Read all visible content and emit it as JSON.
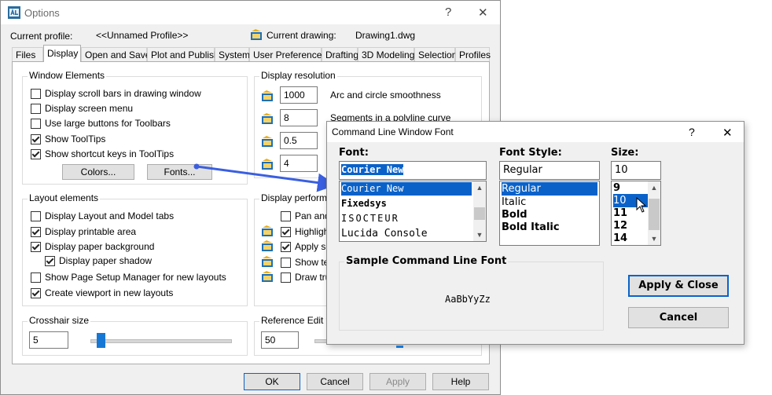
{
  "options": {
    "title": "Options",
    "title_buttons": {
      "help": "?",
      "close": "✕"
    },
    "current_profile_label": "Current profile:",
    "current_profile_value": "<<Unnamed Profile>>",
    "current_drawing_label": "Current drawing:",
    "current_drawing_value": "Drawing1.dwg",
    "tabs": [
      "Files",
      "Display",
      "Open and Save",
      "Plot and Publish",
      "System",
      "User Preferences",
      "Drafting",
      "3D Modeling",
      "Selection",
      "Profiles"
    ],
    "active_tab": "Display",
    "window_elements": {
      "label": "Window Elements",
      "items": [
        {
          "label": "Display scroll bars in drawing window",
          "checked": false
        },
        {
          "label": "Display screen menu",
          "checked": false
        },
        {
          "label": "Use large buttons for Toolbars",
          "checked": false
        },
        {
          "label": "Show ToolTips",
          "checked": true
        },
        {
          "label": "Show shortcut keys in ToolTips",
          "checked": true
        }
      ],
      "colors_button": "Colors...",
      "fonts_button": "Fonts..."
    },
    "layout_elements": {
      "label": "Layout elements",
      "items": [
        {
          "label": "Display Layout and Model tabs",
          "checked": false
        },
        {
          "label": "Display printable area",
          "checked": true
        },
        {
          "label": "Display paper background",
          "checked": true
        },
        {
          "label": "Display paper shadow",
          "checked": true
        },
        {
          "label": "Show Page Setup Manager for new layouts",
          "checked": false
        },
        {
          "label": "Create viewport in new layouts",
          "checked": true
        }
      ]
    },
    "display_resolution": {
      "label": "Display resolution",
      "items": [
        {
          "value": "1000",
          "label": "Arc and circle smoothness"
        },
        {
          "value": "8",
          "label": "Segments in a polyline curve"
        },
        {
          "value": "0.5",
          "label": ""
        },
        {
          "value": "4",
          "label": ""
        }
      ]
    },
    "display_performance": {
      "label": "Display performan",
      "items": [
        {
          "label": "Pan and",
          "checked": false
        },
        {
          "label": "Highlight",
          "checked": true
        },
        {
          "label": "Apply sol",
          "checked": true
        },
        {
          "label": "Show tex",
          "checked": false
        },
        {
          "label": "Draw true",
          "checked": false
        }
      ]
    },
    "crosshair": {
      "label": "Crosshair size",
      "value": "5",
      "level_percent": 5
    },
    "reference_edit": {
      "label": "Reference Edit fa",
      "value": "50"
    },
    "buttons": {
      "ok": "OK",
      "cancel": "Cancel",
      "apply": "Apply",
      "help": "Help"
    }
  },
  "font_dialog": {
    "title": "Command Line Window Font",
    "title_buttons": {
      "help": "?",
      "close": "✕"
    },
    "font_label": "Font:",
    "font_value": "Courier New",
    "font_list": [
      "Courier New",
      "Fixedsys",
      "ISOCTEUR",
      "Lucida Console"
    ],
    "font_selected_index": 0,
    "style_label": "Font Style:",
    "style_value": "Regular",
    "style_list": [
      "Regular",
      "Italic",
      "Bold",
      "Bold Italic"
    ],
    "style_selected_index": 0,
    "size_label": "Size:",
    "size_value": "10",
    "size_list": [
      "9",
      "10",
      "11",
      "12",
      "14"
    ],
    "size_selected_index": 1,
    "sample_label": "Sample Command Line Font",
    "sample_text": "AaBbYyZz",
    "apply_close": "Apply & Close",
    "cancel": "Cancel"
  },
  "colors": {
    "selection": "#0a62c9",
    "arrow": "#3a5fe0",
    "accent": "#1777d5"
  }
}
